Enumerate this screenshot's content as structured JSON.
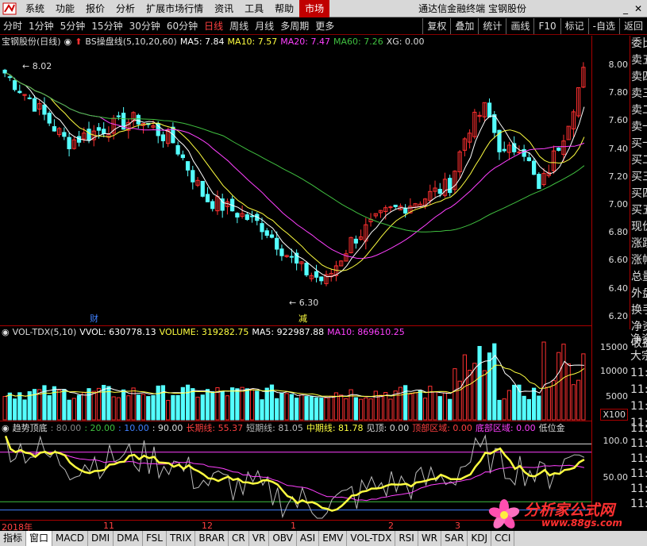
{
  "menubar": {
    "items": [
      "系统",
      "功能",
      "报价",
      "分析",
      "扩展市场行情",
      "资讯",
      "工具",
      "帮助"
    ],
    "market_tab": "市场",
    "app_title": "通达信金融终端 宝钢股份"
  },
  "toolbar": {
    "timeframes": [
      "分时",
      "1分钟",
      "5分钟",
      "15分钟",
      "30分钟",
      "60分钟",
      "日线",
      "周线",
      "月线",
      "多周期",
      "更多"
    ],
    "active_timeframe": "日线",
    "right_buttons": [
      "复权",
      "叠加",
      "统计",
      "画线",
      "F10",
      "标记",
      "-自选",
      "返回"
    ]
  },
  "main_chart": {
    "stock_label": "宝钢股份(日线)",
    "indicator": "BS操盘线(5,10,20,60)",
    "ma5": "MA5: 7.84",
    "ma10": "MA10: 7.57",
    "ma20": "MA20: 7.47",
    "ma60": "MA60: 7.26",
    "xg": "XG: 0.00",
    "high_label": "8.02",
    "low_label": "6.30",
    "marker_cai": "财",
    "marker_jian": "减",
    "y_ticks": [
      "8.00",
      "7.80",
      "7.60",
      "7.40",
      "7.20",
      "7.00",
      "6.80",
      "6.60",
      "6.40",
      "6.20"
    ]
  },
  "side_panel": {
    "items": [
      "委比",
      "卖五",
      "卖四",
      "卖三",
      "卖二",
      "卖一",
      "买一",
      "买二",
      "买三",
      "买四",
      "买五",
      "现价",
      "涨跌",
      "涨幅",
      "总量",
      "外盘",
      "换手",
      "净资",
      "收益"
    ],
    "items2": [
      "净资",
      "大宗",
      "11:",
      "11:",
      "11:",
      "11:"
    ]
  },
  "volume_chart": {
    "indicator": "VOL-TDX(5,10)",
    "vvol": "VVOL: 630778.13",
    "volume": "VOLUME: 319282.75",
    "ma5": "MA5: 922987.88",
    "ma10": "MA10: 869610.25",
    "y_ticks": [
      "15000",
      "10000",
      "5000"
    ],
    "unit": "X100"
  },
  "trend_chart": {
    "indicator": "趋势顶底",
    "v80": ": 80.00",
    "v20": ": 20.00",
    "v10": ": 10.00",
    "v90": ": 90.00",
    "long": "长期线: 55.37",
    "short": "短期线: 81.05",
    "mid": "中期线: 81.78",
    "jianding": "见顶: 0.00",
    "dingbu": "顶部区域: 0.00",
    "dibu": "底部区域: 0.00",
    "diwei": "低位金",
    "y_ticks": [
      "100.0",
      "50.00"
    ],
    "right_side": [
      "11:",
      "11:",
      "11:",
      "11:",
      "11:",
      "11:"
    ]
  },
  "datebar": {
    "labels": [
      "2018年",
      "11",
      "12",
      "1",
      "2",
      "3"
    ]
  },
  "tabbar": {
    "tabs": [
      "指标",
      "窗口",
      "MACD",
      "DMI",
      "DMA",
      "FSL",
      "TRIX",
      "BRAR",
      "CR",
      "VR",
      "OBV",
      "ASI",
      "EMV",
      "VOL-TDX",
      "RSI",
      "WR",
      "SAR",
      "KDJ",
      "CCI"
    ],
    "active": "窗口"
  },
  "watermark": {
    "line1": "分析家公式网",
    "line2": "www.88gs.com"
  },
  "colors": {
    "up": "#ff3030",
    "down": "#54ffff",
    "ma_white": "#ffffff",
    "ma_yellow": "#ffff40",
    "ma_magenta": "#ff40ff",
    "ma_green": "#40c040",
    "accent_red": "#c00000"
  }
}
